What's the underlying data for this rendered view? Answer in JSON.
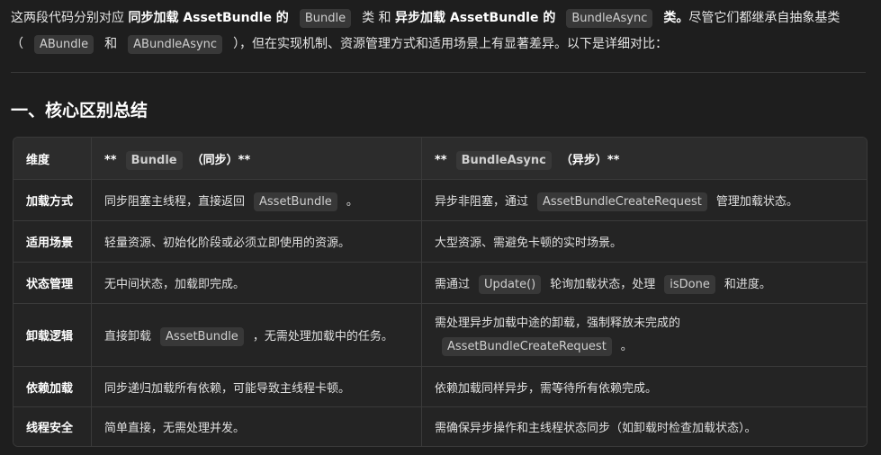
{
  "intro": {
    "line1_a": "这两段代码分别对应",
    "line1_b_bold": "同步加载 AssetBundle 的",
    "code_bundle": "Bundle",
    "line1_c": "类 和",
    "line1_d_bold": "异步加载 AssetBundle 的",
    "code_bundle_async": "BundleAsync",
    "line1_e_bold": "类。",
    "line1_f": "尽管它们都继承自抽象基类",
    "paren_open": "（",
    "code_abundle": "ABundle",
    "line2_and": "和",
    "code_abundle_async": "ABundleAsync",
    "line2_rest": "），但在实现机制、资源管理方式和适用场景上有显著差异。以下是详细对比："
  },
  "section_title": "一、核心区别总结",
  "table": {
    "header": {
      "dimension": "维度",
      "sync_prefix": "**",
      "sync_code": "Bundle",
      "sync_suffix": "（同步）**",
      "async_prefix": "**",
      "async_code": "BundleAsync",
      "async_suffix": "（异步）**"
    },
    "rows": [
      {
        "dimension": "加载方式",
        "sync_text": "同步阻塞主线程，直接返回",
        "sync_code": "AssetBundle",
        "sync_tail": "。",
        "async_text": "异步非阻塞，通过",
        "async_code": "AssetBundleCreateRequest",
        "async_tail": "管理加载状态。"
      },
      {
        "dimension": "适用场景",
        "sync_text": "轻量资源、初始化阶段或必须立即使用的资源。",
        "async_text": "大型资源、需避免卡顿的实时场景。"
      },
      {
        "dimension": "状态管理",
        "sync_text": "无中间状态，加载即完成。",
        "async_text": "需通过",
        "async_code": "Update()",
        "async_mid": "轮询加载状态，处理",
        "async_code2": "isDone",
        "async_tail": "和进度。"
      },
      {
        "dimension": "卸载逻辑",
        "sync_text": "直接卸载",
        "sync_code": "AssetBundle",
        "sync_tail": "，无需处理加载中的任务。",
        "async_text": "需处理异步加载中途的卸载，强制释放未完成的",
        "async_code": "AssetBundleCreateRequest",
        "async_tail": "。"
      },
      {
        "dimension": "依赖加载",
        "sync_text": "同步递归加载所有依赖，可能导致主线程卡顿。",
        "async_text": "依赖加载同样异步，需等待所有依赖完成。"
      },
      {
        "dimension": "线程安全",
        "sync_text": "简单直接，无需处理并发。",
        "async_text": "需确保异步操作和主线程状态同步（如卸载时检查加载状态）。"
      }
    ]
  }
}
